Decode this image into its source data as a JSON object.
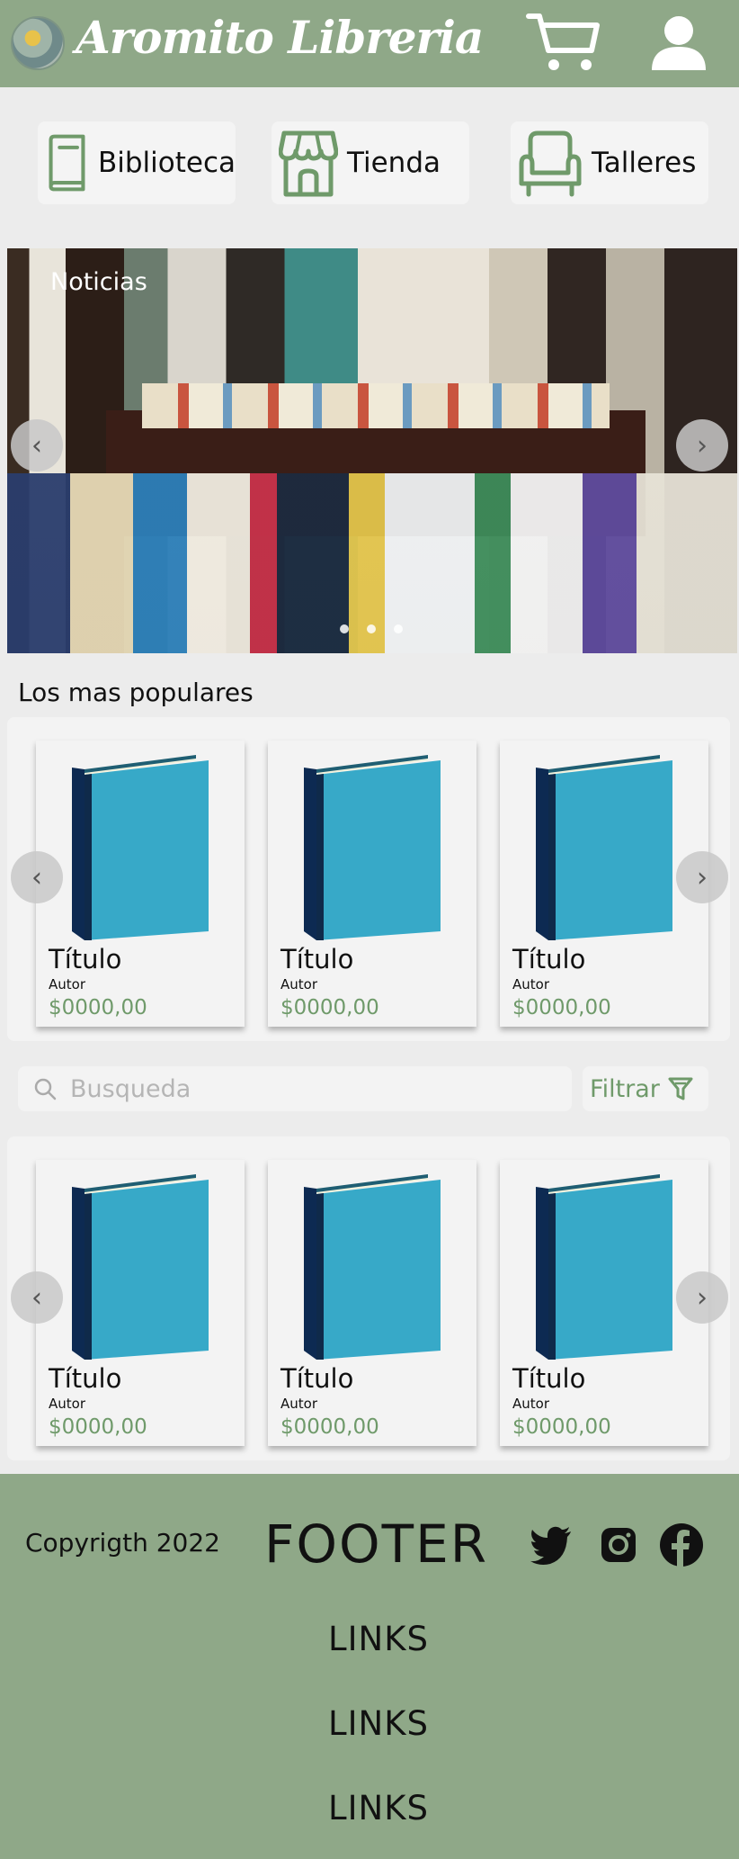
{
  "header": {
    "brand": "Aromito Libreria",
    "cart_icon": "cart-icon",
    "user_icon": "user-icon"
  },
  "nav": {
    "items": [
      {
        "label": "Biblioteca",
        "icon": "book-icon"
      },
      {
        "label": "Tienda",
        "icon": "store-icon"
      },
      {
        "label": "Talleres",
        "icon": "armchair-icon"
      }
    ]
  },
  "carousel": {
    "title": "Noticias",
    "prev": "‹",
    "next": "›",
    "slide_count": 3
  },
  "popular": {
    "title": "Los mas populares",
    "products": [
      {
        "title": "Título",
        "author": "Autor",
        "price": "$0000,00"
      },
      {
        "title": "Título",
        "author": "Autor",
        "price": "$0000,00"
      },
      {
        "title": "Título",
        "author": "Autor",
        "price": "$0000,00"
      }
    ]
  },
  "search": {
    "placeholder": "Busqueda",
    "value": "",
    "filter_label": "Filtrar"
  },
  "results": {
    "products": [
      {
        "title": "Título",
        "author": "Autor",
        "price": "$0000,00"
      },
      {
        "title": "Título",
        "author": "Autor",
        "price": "$0000,00"
      },
      {
        "title": "Título",
        "author": "Autor",
        "price": "$0000,00"
      }
    ]
  },
  "footer": {
    "copyright": "Copyrigth 2022",
    "title": "FOOTER",
    "social": [
      "twitter-icon",
      "instagram-icon",
      "facebook-icon"
    ],
    "links": [
      "LINKS",
      "LINKS",
      "LINKS"
    ]
  },
  "colors": {
    "brand_green": "#8fa888",
    "accent_green": "#6f9a6a",
    "panel_bg": "#f3f3f3",
    "page_bg": "#ececec"
  }
}
